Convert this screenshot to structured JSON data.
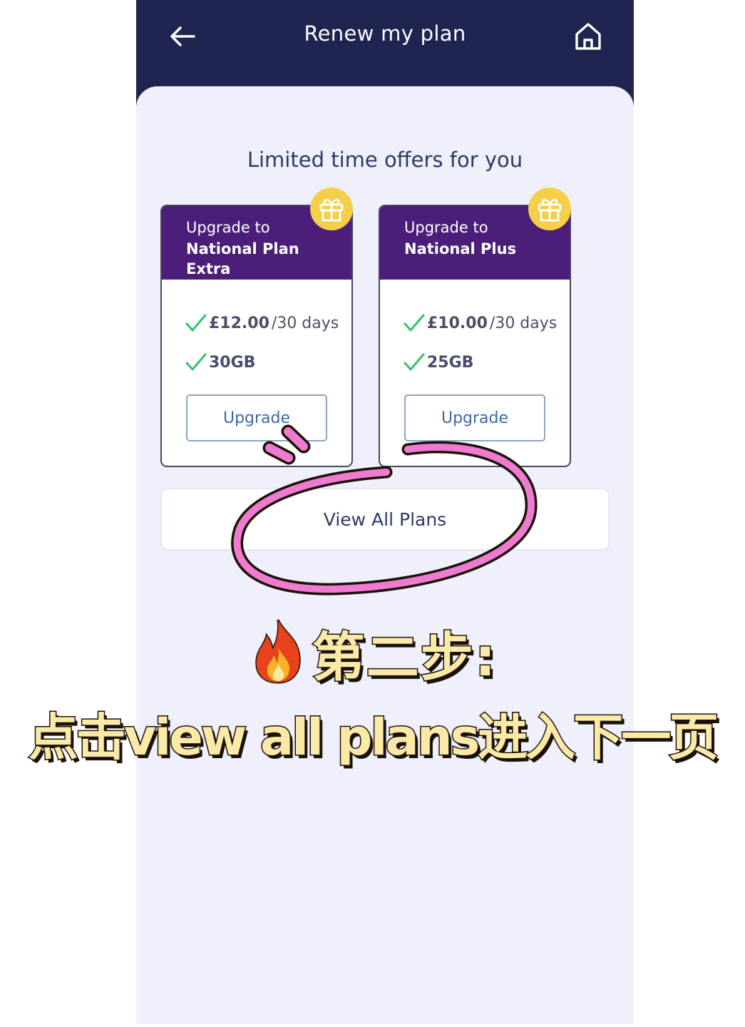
{
  "header": {
    "title": "Renew my plan"
  },
  "offers": {
    "section_title": "Limited time offers for you",
    "cards": [
      {
        "line1": "Upgrade to",
        "line2": "National Plan Extra",
        "price": "£12.00",
        "period": "/30 days",
        "data": "30GB",
        "button_label": "Upgrade"
      },
      {
        "line1": "Upgrade to",
        "line2": "National Plus",
        "price": "£10.00",
        "period": "/30 days",
        "data": "25GB",
        "button_label": "Upgrade"
      }
    ]
  },
  "view_all_label": "View All Plans",
  "annotation": {
    "step_title": "第二步:",
    "instruction": "点击view all plans进入下一页",
    "circle_color": "#ee7bd0"
  },
  "colors": {
    "header_bg": "#1f2450",
    "content_bg": "#eff0fc",
    "card_header": "#4b1e7a",
    "gift_badge": "#f6cf4a",
    "check": "#34c26b",
    "button_text": "#3b68a8"
  }
}
